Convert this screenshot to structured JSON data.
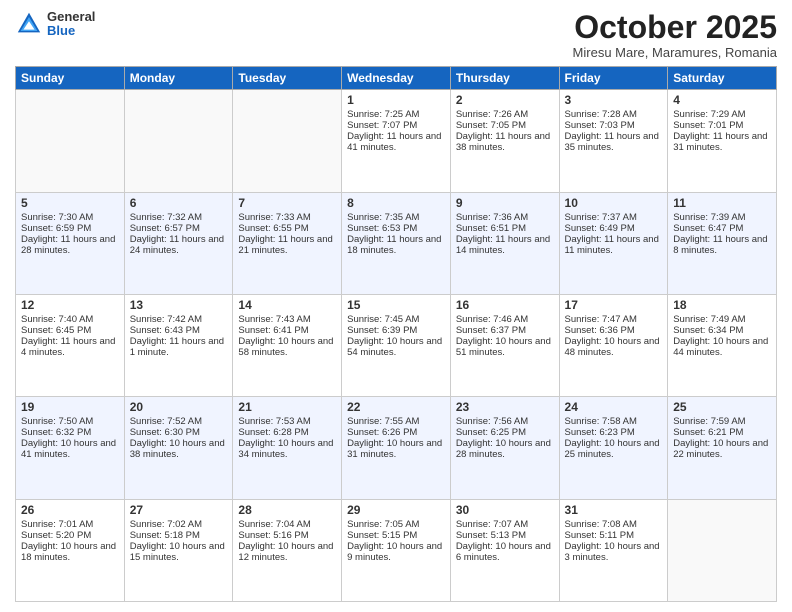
{
  "header": {
    "title": "October 2025",
    "location": "Miresu Mare, Maramures, Romania",
    "logo_general": "General",
    "logo_blue": "Blue"
  },
  "days_of_week": [
    "Sunday",
    "Monday",
    "Tuesday",
    "Wednesday",
    "Thursday",
    "Friday",
    "Saturday"
  ],
  "weeks": [
    [
      {
        "day": "",
        "content": ""
      },
      {
        "day": "",
        "content": ""
      },
      {
        "day": "",
        "content": ""
      },
      {
        "day": "1",
        "content": "Sunrise: 7:25 AM\nSunset: 7:07 PM\nDaylight: 11 hours and 41 minutes."
      },
      {
        "day": "2",
        "content": "Sunrise: 7:26 AM\nSunset: 7:05 PM\nDaylight: 11 hours and 38 minutes."
      },
      {
        "day": "3",
        "content": "Sunrise: 7:28 AM\nSunset: 7:03 PM\nDaylight: 11 hours and 35 minutes."
      },
      {
        "day": "4",
        "content": "Sunrise: 7:29 AM\nSunset: 7:01 PM\nDaylight: 11 hours and 31 minutes."
      }
    ],
    [
      {
        "day": "5",
        "content": "Sunrise: 7:30 AM\nSunset: 6:59 PM\nDaylight: 11 hours and 28 minutes."
      },
      {
        "day": "6",
        "content": "Sunrise: 7:32 AM\nSunset: 6:57 PM\nDaylight: 11 hours and 24 minutes."
      },
      {
        "day": "7",
        "content": "Sunrise: 7:33 AM\nSunset: 6:55 PM\nDaylight: 11 hours and 21 minutes."
      },
      {
        "day": "8",
        "content": "Sunrise: 7:35 AM\nSunset: 6:53 PM\nDaylight: 11 hours and 18 minutes."
      },
      {
        "day": "9",
        "content": "Sunrise: 7:36 AM\nSunset: 6:51 PM\nDaylight: 11 hours and 14 minutes."
      },
      {
        "day": "10",
        "content": "Sunrise: 7:37 AM\nSunset: 6:49 PM\nDaylight: 11 hours and 11 minutes."
      },
      {
        "day": "11",
        "content": "Sunrise: 7:39 AM\nSunset: 6:47 PM\nDaylight: 11 hours and 8 minutes."
      }
    ],
    [
      {
        "day": "12",
        "content": "Sunrise: 7:40 AM\nSunset: 6:45 PM\nDaylight: 11 hours and 4 minutes."
      },
      {
        "day": "13",
        "content": "Sunrise: 7:42 AM\nSunset: 6:43 PM\nDaylight: 11 hours and 1 minute."
      },
      {
        "day": "14",
        "content": "Sunrise: 7:43 AM\nSunset: 6:41 PM\nDaylight: 10 hours and 58 minutes."
      },
      {
        "day": "15",
        "content": "Sunrise: 7:45 AM\nSunset: 6:39 PM\nDaylight: 10 hours and 54 minutes."
      },
      {
        "day": "16",
        "content": "Sunrise: 7:46 AM\nSunset: 6:37 PM\nDaylight: 10 hours and 51 minutes."
      },
      {
        "day": "17",
        "content": "Sunrise: 7:47 AM\nSunset: 6:36 PM\nDaylight: 10 hours and 48 minutes."
      },
      {
        "day": "18",
        "content": "Sunrise: 7:49 AM\nSunset: 6:34 PM\nDaylight: 10 hours and 44 minutes."
      }
    ],
    [
      {
        "day": "19",
        "content": "Sunrise: 7:50 AM\nSunset: 6:32 PM\nDaylight: 10 hours and 41 minutes."
      },
      {
        "day": "20",
        "content": "Sunrise: 7:52 AM\nSunset: 6:30 PM\nDaylight: 10 hours and 38 minutes."
      },
      {
        "day": "21",
        "content": "Sunrise: 7:53 AM\nSunset: 6:28 PM\nDaylight: 10 hours and 34 minutes."
      },
      {
        "day": "22",
        "content": "Sunrise: 7:55 AM\nSunset: 6:26 PM\nDaylight: 10 hours and 31 minutes."
      },
      {
        "day": "23",
        "content": "Sunrise: 7:56 AM\nSunset: 6:25 PM\nDaylight: 10 hours and 28 minutes."
      },
      {
        "day": "24",
        "content": "Sunrise: 7:58 AM\nSunset: 6:23 PM\nDaylight: 10 hours and 25 minutes."
      },
      {
        "day": "25",
        "content": "Sunrise: 7:59 AM\nSunset: 6:21 PM\nDaylight: 10 hours and 22 minutes."
      }
    ],
    [
      {
        "day": "26",
        "content": "Sunrise: 7:01 AM\nSunset: 5:20 PM\nDaylight: 10 hours and 18 minutes."
      },
      {
        "day": "27",
        "content": "Sunrise: 7:02 AM\nSunset: 5:18 PM\nDaylight: 10 hours and 15 minutes."
      },
      {
        "day": "28",
        "content": "Sunrise: 7:04 AM\nSunset: 5:16 PM\nDaylight: 10 hours and 12 minutes."
      },
      {
        "day": "29",
        "content": "Sunrise: 7:05 AM\nSunset: 5:15 PM\nDaylight: 10 hours and 9 minutes."
      },
      {
        "day": "30",
        "content": "Sunrise: 7:07 AM\nSunset: 5:13 PM\nDaylight: 10 hours and 6 minutes."
      },
      {
        "day": "31",
        "content": "Sunrise: 7:08 AM\nSunset: 5:11 PM\nDaylight: 10 hours and 3 minutes."
      },
      {
        "day": "",
        "content": ""
      }
    ]
  ]
}
